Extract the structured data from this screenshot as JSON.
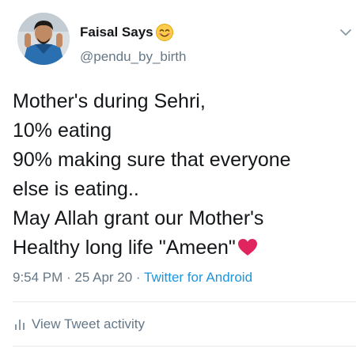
{
  "tweet": {
    "author": {
      "display_name": "Faisal Says",
      "name_emoji": "smiling-face-with-smiling-eyes-icon",
      "handle": "@pendu_by_birth"
    },
    "text_lines": [
      "Mother's during Sehri,",
      "10% eating",
      "90% making sure that everyone",
      "else is eating..",
      "May Allah grant our Mother's",
      "Healthy long life \"Ameen\""
    ],
    "text_trailing_emoji": "red-heart-icon",
    "meta": {
      "time": "9:54 PM",
      "separator": " · ",
      "date": "25 Apr 20",
      "source": "Twitter for Android"
    },
    "activity_label": "View Tweet activity"
  },
  "colors": {
    "primary_text": "#14171a",
    "secondary_text": "#657786",
    "link": "#1b95e0",
    "divider": "#e6ecf0",
    "heart": "#e0245e"
  }
}
